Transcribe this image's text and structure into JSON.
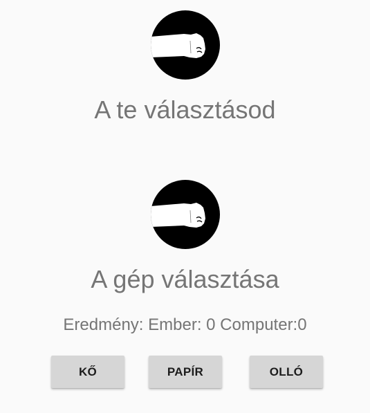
{
  "player": {
    "choice_icon": "fist-icon",
    "caption": "A te választásod"
  },
  "computer": {
    "choice_icon": "fist-icon",
    "caption": "A gép választása"
  },
  "score": {
    "prefix": "Eredmény: ",
    "human_label": "Ember: ",
    "human_value": "0",
    "computer_label": " Computer:",
    "computer_value": "0"
  },
  "buttons": {
    "rock": "KŐ",
    "paper": "PAPÍR",
    "scissors": "OLLÓ"
  },
  "colors": {
    "background": "#fafafa",
    "circle": "#000000",
    "icon": "#ffffff",
    "text": "#757575",
    "button": "#d6d6d6"
  }
}
